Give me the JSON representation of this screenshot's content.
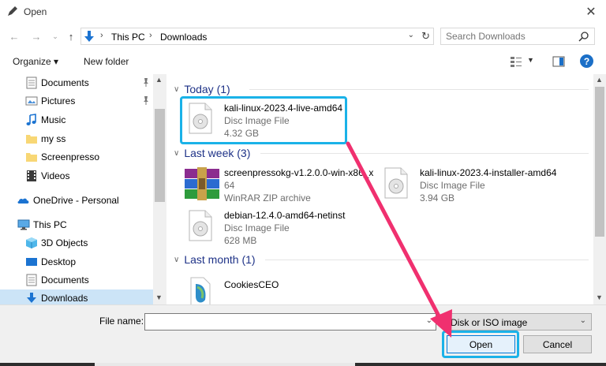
{
  "window": {
    "title": "Open"
  },
  "address": {
    "crumbs": [
      "This PC",
      "Downloads"
    ]
  },
  "search": {
    "placeholder": "Search Downloads"
  },
  "toolbar": {
    "organize": "Organize ▾",
    "new_folder": "New folder"
  },
  "sidebar": {
    "items": [
      {
        "label": "Documents",
        "icon": "documents-icon",
        "pinned": true
      },
      {
        "label": "Pictures",
        "icon": "pictures-icon",
        "pinned": true
      },
      {
        "label": "Music",
        "icon": "music-icon"
      },
      {
        "label": "my ss",
        "icon": "folder-icon"
      },
      {
        "label": "Screenpresso",
        "icon": "folder-icon"
      },
      {
        "label": "Videos",
        "icon": "videos-icon"
      },
      {
        "label": "OneDrive - Personal",
        "icon": "onedrive-icon"
      },
      {
        "label": "This PC",
        "icon": "this-pc-icon"
      },
      {
        "label": "3D Objects",
        "icon": "3d-objects-icon"
      },
      {
        "label": "Desktop",
        "icon": "desktop-icon"
      },
      {
        "label": "Documents",
        "icon": "documents-icon"
      },
      {
        "label": "Downloads",
        "icon": "downloads-icon",
        "selected": true
      }
    ]
  },
  "groups": [
    {
      "title": "Today (1)"
    },
    {
      "title": "Last week (3)"
    },
    {
      "title": "Last month (1)"
    }
  ],
  "files": [
    {
      "name": "kali-linux-2023.4-live-amd64",
      "type": "Disc Image File",
      "size": "4.32 GB",
      "icon": "disc-image-icon"
    },
    {
      "name": "screenpressokg-v1.2.0.0-win-x86_x",
      "name2": "64",
      "type": "WinRAR ZIP archive",
      "size": "",
      "icon": "winrar-icon"
    },
    {
      "name": "kali-linux-2023.4-installer-amd64",
      "type": "Disc Image File",
      "size": "3.94 GB",
      "icon": "disc-image-icon"
    },
    {
      "name": "debian-12.4.0-amd64-netinst",
      "type": "Disc Image File",
      "size": "628 MB",
      "icon": "disc-image-icon"
    },
    {
      "name": "CookiesCEO",
      "type": "",
      "size": "",
      "icon": "app-icon"
    }
  ],
  "bottom": {
    "file_name_label": "File name:",
    "file_name_value": "",
    "filter": "Disk or ISO image",
    "open": "Open",
    "cancel": "Cancel"
  },
  "colors": {
    "accent": "#0078d7",
    "highlight": "#1ab2e8",
    "arrow": "#f0306f",
    "group_title": "#1e3287"
  }
}
